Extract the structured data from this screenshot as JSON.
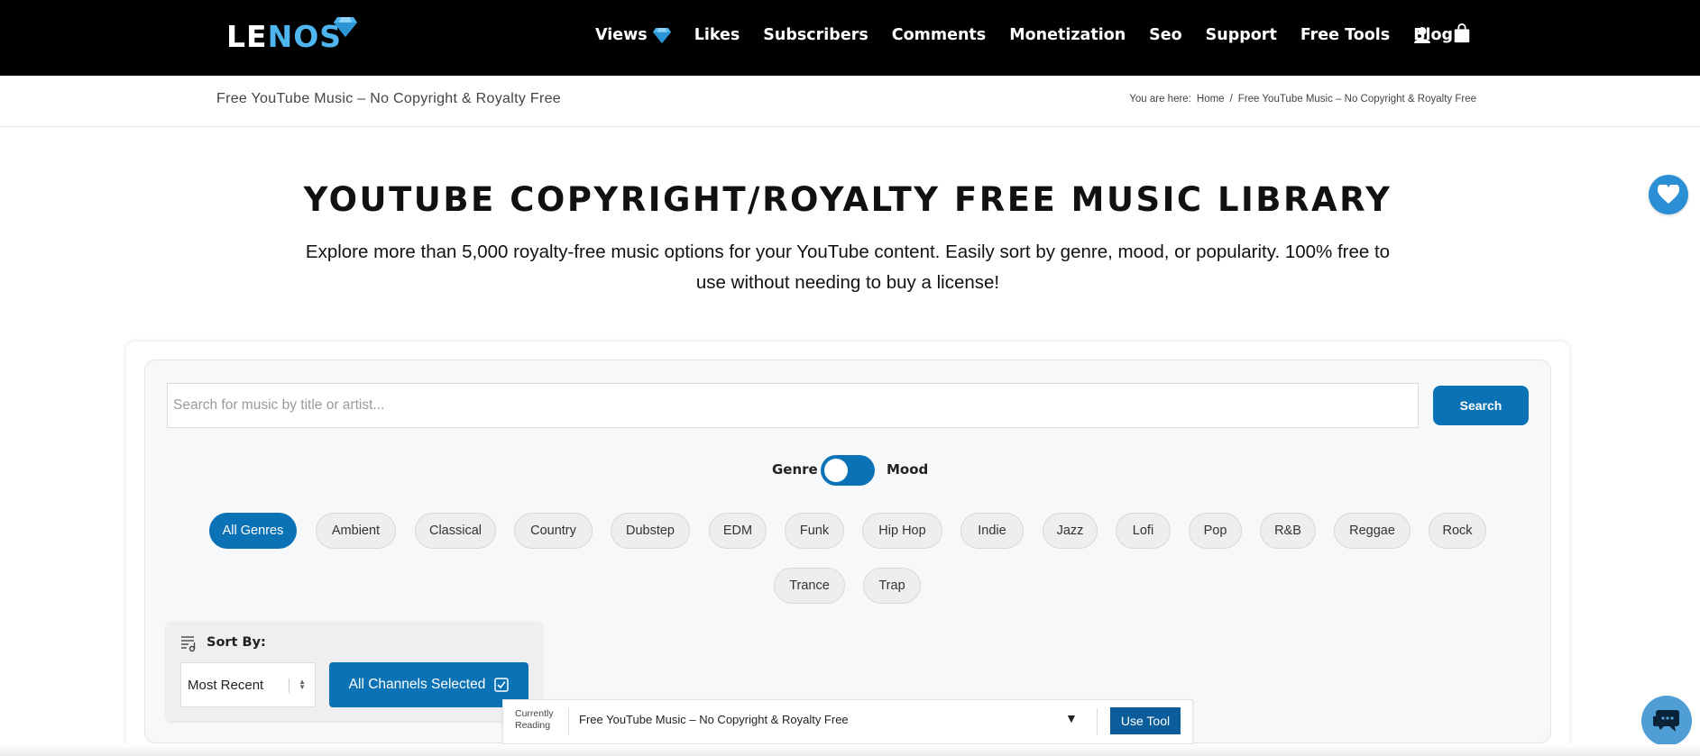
{
  "header": {
    "logo_part1": "LE",
    "logo_part2": "NOS",
    "nav": [
      {
        "label": "Views"
      },
      {
        "label": "Likes"
      },
      {
        "label": "Subscribers"
      },
      {
        "label": "Comments"
      },
      {
        "label": "Monetization"
      },
      {
        "label": "Seo"
      },
      {
        "label": "Support"
      },
      {
        "label": "Free Tools"
      },
      {
        "label": "Blog"
      }
    ],
    "icons": [
      "user-icon",
      "shopping-bag-icon"
    ],
    "accent": "#4fb5ee"
  },
  "breadcrumb": {
    "page_title": "Free YouTube Music – No Copyright & Royalty Free",
    "prefix": "You are here:",
    "home": "Home",
    "separator": "/",
    "current": "Free YouTube Music – No Copyright & Royalty Free"
  },
  "hero": {
    "title": "YOUTUBE COPYRIGHT/ROYALTY FREE MUSIC LIBRARY",
    "subtitle": "Explore more than 5,000 royalty-free music options for your YouTube content. Easily sort by genre, mood, or popularity. 100% free to use without needing to buy a license!"
  },
  "tool": {
    "search_placeholder": "Search for music by title or artist...",
    "search_value": "",
    "search_button": "Search",
    "toggle_left": "Genre",
    "toggle_right": "Mood",
    "genres": [
      "All Genres",
      "Ambient",
      "Classical",
      "Country",
      "Dubstep",
      "EDM",
      "Funk",
      "Hip Hop",
      "Indie",
      "Jazz",
      "Lofi",
      "Pop",
      "R&B",
      "Reggae",
      "Rock",
      "Trance",
      "Trap"
    ],
    "active_genre": "All Genres",
    "sort_label": "Sort By:",
    "sort_value": "Most Recent",
    "channels_button": "All Channels Selected",
    "primary_color": "#0a72b5"
  },
  "reading_bar": {
    "label": "Currently Reading",
    "title": "Free YouTube Music – No Copyright & Royalty Free",
    "caret": "▼",
    "button": "Use Tool"
  },
  "floating": {
    "heart_icon": "heart-icon",
    "chat_icon": "chat-icon"
  }
}
